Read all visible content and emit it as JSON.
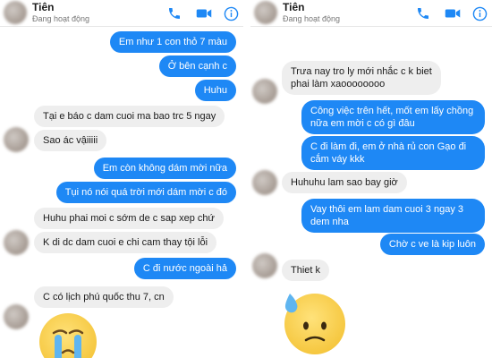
{
  "left": {
    "header": {
      "title": "Tiên",
      "status": "Đang hoạt động"
    },
    "messages": [
      {
        "text": "Em như 1 con thỏ 7 màu"
      },
      {
        "text": "Ở bên cạnh c"
      },
      {
        "text": "Huhu"
      },
      {
        "text": "Tại e báo c dam cuoi ma bao trc 5 ngay"
      },
      {
        "text": "Sao ác vậiiiii"
      },
      {
        "text": "Em còn không dám mời nữa"
      },
      {
        "text": "Tụi nó nói quá trời mới dám mời c đó"
      },
      {
        "text": "Huhu phai moi c sớm de c sap xep chứ"
      },
      {
        "text": "K di dc dam cuoi e chi cam thay tội lỗi"
      },
      {
        "text": "C đi nước ngoài hả"
      },
      {
        "text": "C có lịch phú quốc thu 7, cn"
      }
    ]
  },
  "right": {
    "header": {
      "title": "Tiên",
      "status": "Đang hoạt động"
    },
    "messages": [
      {
        "text": "Trưa nay tro ly mới nhắc c k biet phai làm xaoooooooo"
      },
      {
        "text": "Công việc trên hết, mốt em lấy chồng nữa em mời c có gì đâu"
      },
      {
        "text": "C đi làm đi, em ở nhà rủ con Gạo đi cắm váy kkk"
      },
      {
        "text": "Huhuhu lam sao bay giờ"
      },
      {
        "text": "Vay thôi em lam dam cuoi 3 ngay 3 dem nha"
      },
      {
        "text": "Chờ c ve là kip luôn"
      },
      {
        "text": "Thiet k"
      }
    ]
  },
  "colors": {
    "accent": "#1e88f5",
    "incoming": "#eeeeee"
  },
  "icons": [
    "phone-icon",
    "video-icon",
    "info-icon",
    "crying-emoji-icon",
    "sweat-emoji-icon"
  ]
}
